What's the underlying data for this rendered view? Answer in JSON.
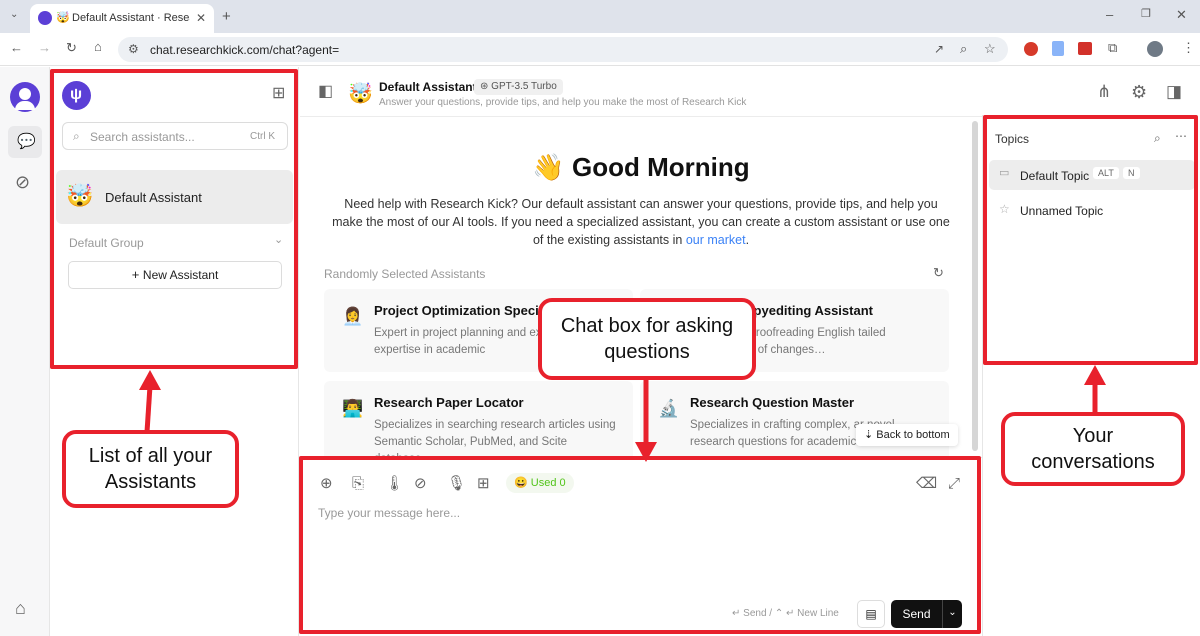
{
  "browser": {
    "tab_title": "Default Assistant · Research",
    "url": "chat.researchkick.com/chat?agent="
  },
  "left_panel": {
    "search_placeholder": "Search assistants...",
    "search_shortcut": "Ctrl K",
    "active_assistant": "Default Assistant",
    "group_label": "Default Group",
    "new_assistant_label": "New Assistant"
  },
  "header": {
    "assistant_name": "Default Assistant",
    "model_badge": "GPT-3.5 Turbo",
    "subtitle": "Answer your questions, provide tips, and help you make the most of Research Kick"
  },
  "welcome": {
    "emoji": "👋",
    "greeting": "Good Morning",
    "intro_text": "Need help with Research Kick? Our default assistant can answer your questions, provide tips, and help you make the most of our AI tools. If you need a specialized assistant, you can create a custom assistant or use one of the existing assistants in",
    "link_text": "our market",
    "section_label": "Randomly Selected Assistants"
  },
  "cards": [
    {
      "emoji": "👩‍💼",
      "title": "Project Optimization Speci",
      "desc": "Expert in project planning and ex leveraging expertise in academic"
    },
    {
      "emoji": "",
      "title": "ng and Copyediting Assistant",
      "desc": "editing and proofreading English tailed explanations of changes…"
    },
    {
      "emoji": "👨‍💻",
      "title": "Research Paper Locator",
      "desc": "Specializes in searching research articles using Semantic Scholar, PubMed, and Scite database…"
    },
    {
      "emoji": "🔬",
      "title": "Research Question Master",
      "desc": "Specializes in crafting complex, ar novel research questions for academic…"
    }
  ],
  "back_to_bottom": "Back to bottom",
  "input": {
    "used_label": "Used 0",
    "placeholder": "Type your message here...",
    "hint": "↵ Send / ⌃ ↵ New Line",
    "send_label": "Send"
  },
  "topics": {
    "title": "Topics",
    "items": [
      {
        "label": "Default Topic",
        "badges": [
          "ALT",
          "N"
        ]
      },
      {
        "label": "Unnamed Topic",
        "badges": []
      }
    ]
  },
  "annotations": {
    "chat_box": "Chat box for asking questions",
    "assistants_list": "List of all your Assistants",
    "conversations": "Your conversations"
  },
  "colors": {
    "annotation_red": "#e8212c",
    "send_button": "#111111",
    "link": "#3b82f6",
    "used_green": "#52c41a"
  }
}
